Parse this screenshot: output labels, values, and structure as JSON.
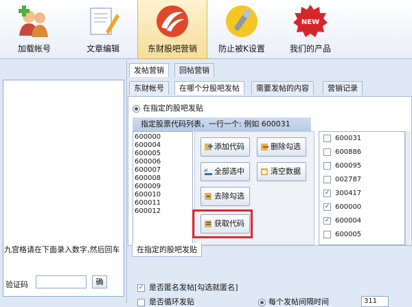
{
  "toolbar": {
    "items": [
      {
        "label": "加载帐号",
        "icon": "users-add-icon"
      },
      {
        "label": "文章编辑",
        "icon": "edit-document-icon"
      },
      {
        "label": "东财股吧营销",
        "icon": "eastmoney-logo-icon"
      },
      {
        "label": "防止被K设置",
        "icon": "wrench-icon"
      },
      {
        "label": "我们的产品",
        "icon": "new-badge-icon",
        "badge": "NEW"
      }
    ],
    "active_index": 2
  },
  "left": {
    "tip": "九宫格请在下面录入数字,然后回车",
    "captcha_label": "验证码",
    "captcha_button": "确"
  },
  "tabs_top": [
    "发帖营销",
    "回帖营销"
  ],
  "tabs_sub": [
    "东财帐号",
    "在哪个分股吧发帖",
    "需要发帖的内容",
    "营销记录"
  ],
  "panel": {
    "radio_label": "在指定的股吧发贴",
    "list_header": "指定股票代码列表，一行一个: 例如 600031",
    "codes": [
      "600000",
      "600004",
      "600005",
      "600006",
      "600007",
      "600008",
      "600009",
      "600010",
      "600011",
      "600012"
    ],
    "buttons": {
      "add": "添加代码",
      "delete_checked": "删除勾选",
      "select_all": "全部选中",
      "clear": "清空数据",
      "uncheck": "去除勾选",
      "fetch": "获取代码"
    },
    "checklist": [
      {
        "code": "600031",
        "checked": false
      },
      {
        "code": "600886",
        "checked": false
      },
      {
        "code": "600095",
        "checked": false
      },
      {
        "code": "002787",
        "checked": false
      },
      {
        "code": "300417",
        "checked": true
      },
      {
        "code": "600000",
        "checked": true
      },
      {
        "code": "600004",
        "checked": true
      },
      {
        "code": "600005",
        "checked": false
      }
    ],
    "bottom_tab": "在指定的股吧发贴"
  },
  "options": {
    "anonymous": "是否匿名发帖[勾选就匿名]",
    "loop": "是否循环发贴",
    "interval_label": "每个发帖间隔时间",
    "interval_value": "311"
  },
  "colors": {
    "highlight": "#e0272d",
    "active_tab": "#f6dd9a"
  }
}
